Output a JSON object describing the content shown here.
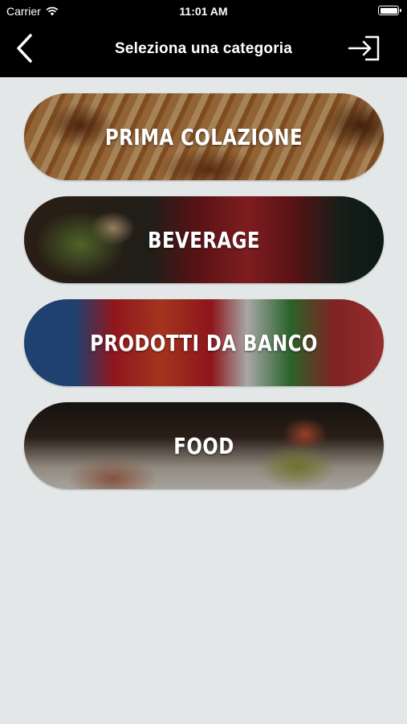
{
  "status_bar": {
    "carrier": "Carrier",
    "time": "11:01 AM"
  },
  "nav": {
    "title": "Seleziona una categoria",
    "back_icon": "chevron-left-icon",
    "login_icon": "sign-in-icon"
  },
  "categories": [
    {
      "label": "PRIMA COLAZIONE"
    },
    {
      "label": "BEVERAGE"
    },
    {
      "label": "PRODOTTI DA BANCO"
    },
    {
      "label": "FOOD"
    }
  ],
  "colors": {
    "bar_background": "#000000",
    "page_background": "#e3e7e8",
    "label_text": "#ffffff"
  }
}
